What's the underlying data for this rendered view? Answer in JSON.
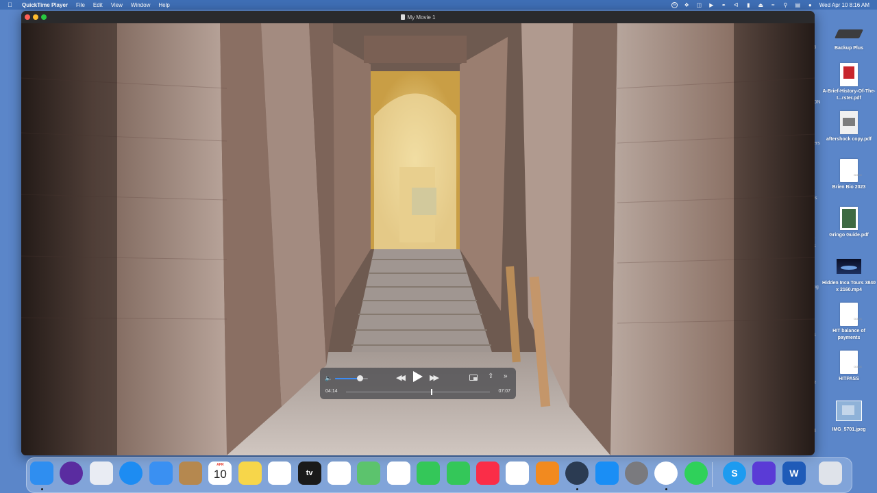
{
  "menubar": {
    "apple_icon": "apple-logo",
    "app_name": "QuickTime Player",
    "menus": [
      "File",
      "Edit",
      "View",
      "Window",
      "Help"
    ],
    "clock": "Wed Apr 10  8:16 AM"
  },
  "window": {
    "title": "My Movie 1"
  },
  "player": {
    "current_time": "04:14",
    "end_time": "07:07",
    "progress": 0.59,
    "volume": 0.74
  },
  "desktop_side_fragments": [
    "3",
    "ON",
    "ers",
    "r",
    "ts",
    "r",
    "s",
    "ng",
    "1",
    "2",
    "4"
  ],
  "desktop_icons": [
    {
      "label": "Backup Plus",
      "kind": "drive"
    },
    {
      "label": "A-Brief-History-Of-The-I...rster.pdf",
      "kind": "pdf-red"
    },
    {
      "label": "aftershock copy.pdf",
      "kind": "pdf-gray"
    },
    {
      "label": "Brien Bio 2023",
      "kind": "docx"
    },
    {
      "label": "Gringo Guide.pdf",
      "kind": "pdf-green"
    },
    {
      "label": "Hidden Inca Tours 3840 x 2160.mp4",
      "kind": "video"
    },
    {
      "label": "HIT balance of payments",
      "kind": "docx"
    },
    {
      "label": "HITPASS",
      "kind": "docx"
    },
    {
      "label": "IMG_5701.jpeg",
      "kind": "image"
    }
  ],
  "doc_badge": "DOCX",
  "calendar": {
    "month": "APR",
    "day": "10"
  },
  "dock_apps": [
    {
      "name": "Finder",
      "color": "#2f8ef0"
    },
    {
      "name": "Siri",
      "color": "#5a2ca0"
    },
    {
      "name": "Launchpad",
      "color": "#e9ecf3"
    },
    {
      "name": "Safari",
      "color": "#1d8cf2"
    },
    {
      "name": "Mail",
      "color": "#3a90f2"
    },
    {
      "name": "Contacts",
      "color": "#b5884f"
    },
    {
      "name": "Calendar",
      "color": "#ffffff"
    },
    {
      "name": "Notes",
      "color": "#f7d64a"
    },
    {
      "name": "Freeform",
      "color": "#ffffff"
    },
    {
      "name": "TV",
      "color": "#1a1a1a"
    },
    {
      "name": "Reminders",
      "color": "#ffffff"
    },
    {
      "name": "Maps",
      "color": "#5cc36d"
    },
    {
      "name": "Photos",
      "color": "#ffffff"
    },
    {
      "name": "Messages",
      "color": "#34c759"
    },
    {
      "name": "FaceTime",
      "color": "#34c759"
    },
    {
      "name": "Music",
      "color": "#fa2d48"
    },
    {
      "name": "News",
      "color": "#ffffff"
    },
    {
      "name": "Books",
      "color": "#f28a1f"
    },
    {
      "name": "QuickTime Player",
      "color": "#2b3b52"
    },
    {
      "name": "App Store",
      "color": "#1a8ef5"
    },
    {
      "name": "System Settings",
      "color": "#7a7a7e"
    },
    {
      "name": "Chrome",
      "color": "#ffffff"
    },
    {
      "name": "WhatsApp",
      "color": "#2fd15a"
    },
    {
      "name": "Skype",
      "color": "#1d9bf0"
    },
    {
      "name": "iMovie",
      "color": "#5a3bd6"
    },
    {
      "name": "Word",
      "color": "#1f5bb8"
    },
    {
      "name": "Trash",
      "color": "#dfe3ea"
    }
  ],
  "dock_glyphs": {
    "tv": "tv",
    "word": "W",
    "skype": "S"
  }
}
